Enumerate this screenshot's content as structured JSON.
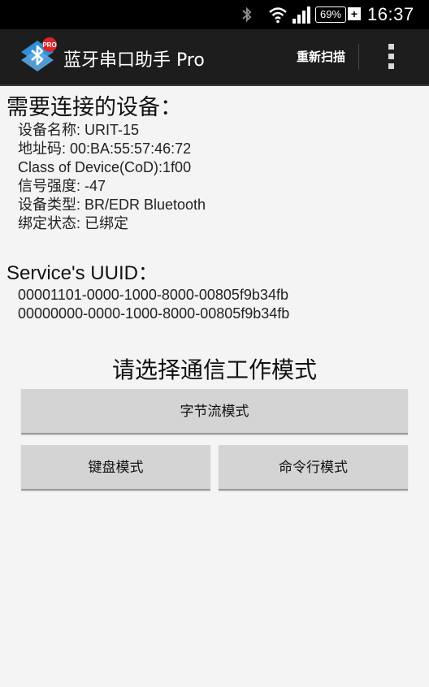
{
  "status_bar": {
    "battery_level": "69%",
    "battery_plus": "+",
    "time": "16:37",
    "icons": [
      "bluetooth-icon",
      "wifi-icon",
      "signal-icon",
      "battery-icon"
    ]
  },
  "action_bar": {
    "title": "蓝牙串口助手 Pro",
    "logo_badge": "PRO",
    "rescan_label": "重新扫描",
    "overflow_icon": "overflow-menu-icon"
  },
  "device_section": {
    "heading": "需要连接的设备：",
    "items": [
      "设备名称: URIT-15",
      "地址码: 00:BA:55:57:46:72",
      "Class of Device(CoD):1f00",
      "信号强度: -47",
      "设备类型: BR/EDR Bluetooth",
      "绑定状态: 已绑定"
    ]
  },
  "uuid_section": {
    "heading": "Service's UUID：",
    "items": [
      "00001101-0000-1000-8000-00805f9b34fb",
      "00000000-0000-1000-8000-00805f9b34fb"
    ]
  },
  "mode_section": {
    "prompt": "请选择通信工作模式",
    "byte_stream_label": "字节流模式",
    "keyboard_label": "键盘模式",
    "command_line_label": "命令行模式"
  },
  "colors": {
    "status_bar_bg": "#000000",
    "action_bar_bg": "#1d1d1d",
    "page_bg": "#f4f4f4",
    "button_bg": "#d4d4d4",
    "logo_blue": "#2f8fd8",
    "badge_red": "#d7262b"
  }
}
